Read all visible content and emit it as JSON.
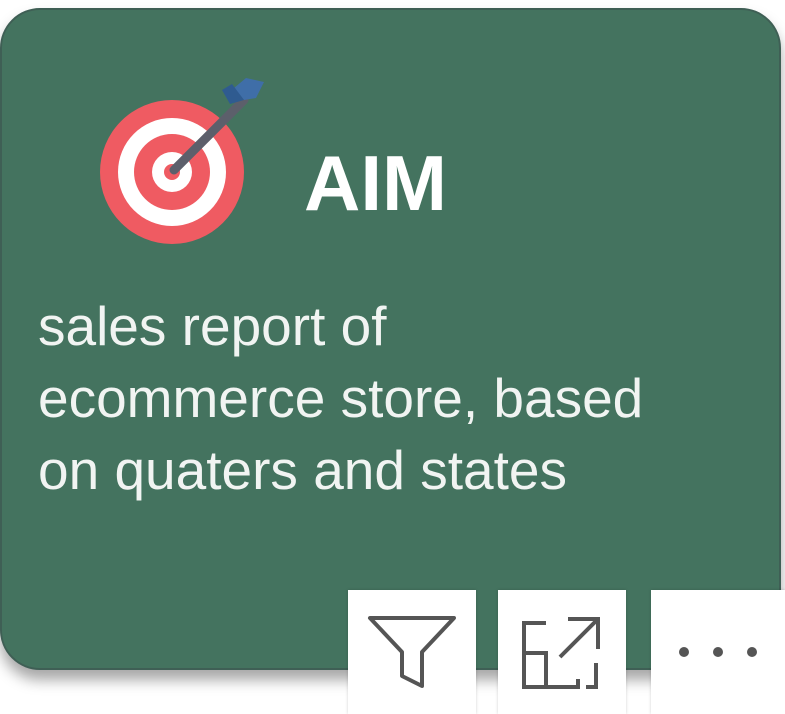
{
  "card": {
    "background_color": "#44735f",
    "title": "AIM",
    "description_lines": [
      "sales report of",
      "ecommerce store, based",
      "on quaters and states"
    ],
    "icon": "target-arrow-icon"
  },
  "toolbar": {
    "filter_icon": "filter-icon",
    "focus_icon": "focus-mode-icon",
    "more_icon": "more-options-icon",
    "more_label": "• • •"
  }
}
